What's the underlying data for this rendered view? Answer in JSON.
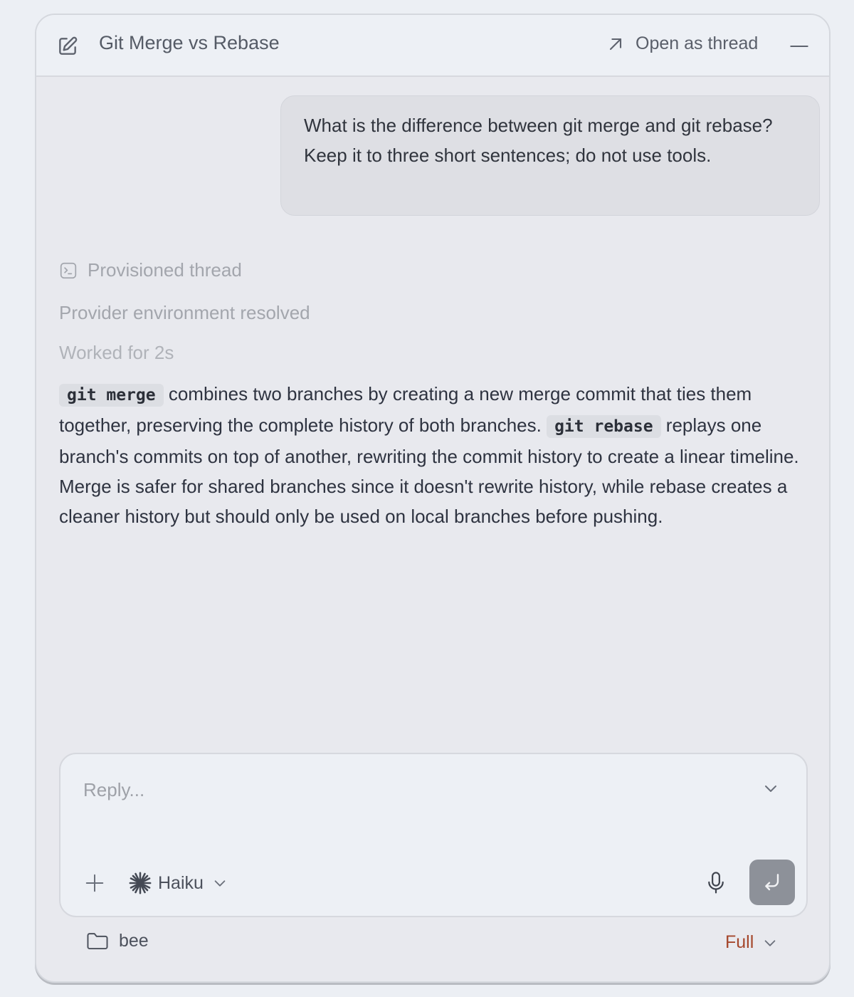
{
  "header": {
    "title": "Git Merge vs Rebase",
    "open_as_thread_label": "Open as thread",
    "icons": [
      "edit-icon",
      "arrow-up-right-icon",
      "minimize-icon"
    ]
  },
  "conversation": {
    "user_message": "What is the difference between git merge and git rebase? Keep it to three short sentences; do not use tools.",
    "status": {
      "provisioned": "Provisioned thread",
      "environment": "Provider environment resolved",
      "worked": "Worked for 2s"
    },
    "answer": {
      "code1": "git merge",
      "text1": " combines two branches by creating a new merge commit that ties them together, preserving the complete history of both branches. ",
      "code2": "git rebase",
      "text2": " replays one branch's commits on top of another, rewriting the commit history to create a linear timeline. Merge is safer for shared branches since it doesn't rewrite history, while rebase creates a cleaner history but should only be used on local branches before pushing."
    }
  },
  "composer": {
    "placeholder": "Reply...",
    "model_label": "Haiku"
  },
  "footer": {
    "folder_label": "bee",
    "mode_label": "Full"
  },
  "colors": {
    "mode_accent": "#a5472c",
    "send_button": "#8d9199"
  }
}
